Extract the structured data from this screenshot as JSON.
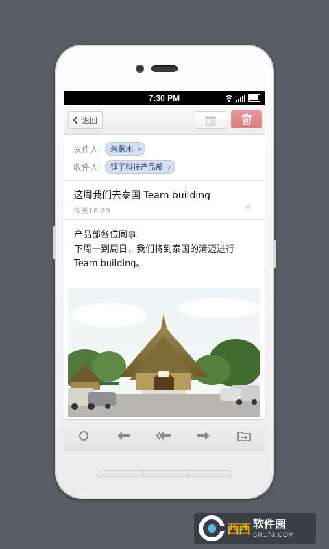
{
  "status_bar": {
    "time": "7:30 PM"
  },
  "toolbar": {
    "back_label": "返回"
  },
  "mail": {
    "from_label": "发件人:",
    "from": "朱萧木",
    "to_label": "收件人:",
    "to": "锤子科技产品部",
    "subject": "这周我们去泰国 Team building",
    "date": "今天16:29",
    "body_lines": [
      "产品部各位同事:",
      "下周一到周日，我们将到泰国的清迈进行",
      "Team building。"
    ]
  },
  "icons": {
    "back": "chevron-left-icon",
    "calendar": "calendar-icon",
    "delete": "trash-icon",
    "star": "star-icon",
    "bottom": [
      "circle-icon",
      "reply-icon",
      "reply-all-icon",
      "forward-icon",
      "move-to-folder-icon"
    ]
  },
  "watermark": {
    "brand": "西西",
    "title": "软件园",
    "url": "CR173.COM"
  },
  "colors": {
    "background": "#5a5d66",
    "delete_button": "#d97c7c",
    "chip": "#d5dff1",
    "watermark_brand": "#f4b300"
  }
}
